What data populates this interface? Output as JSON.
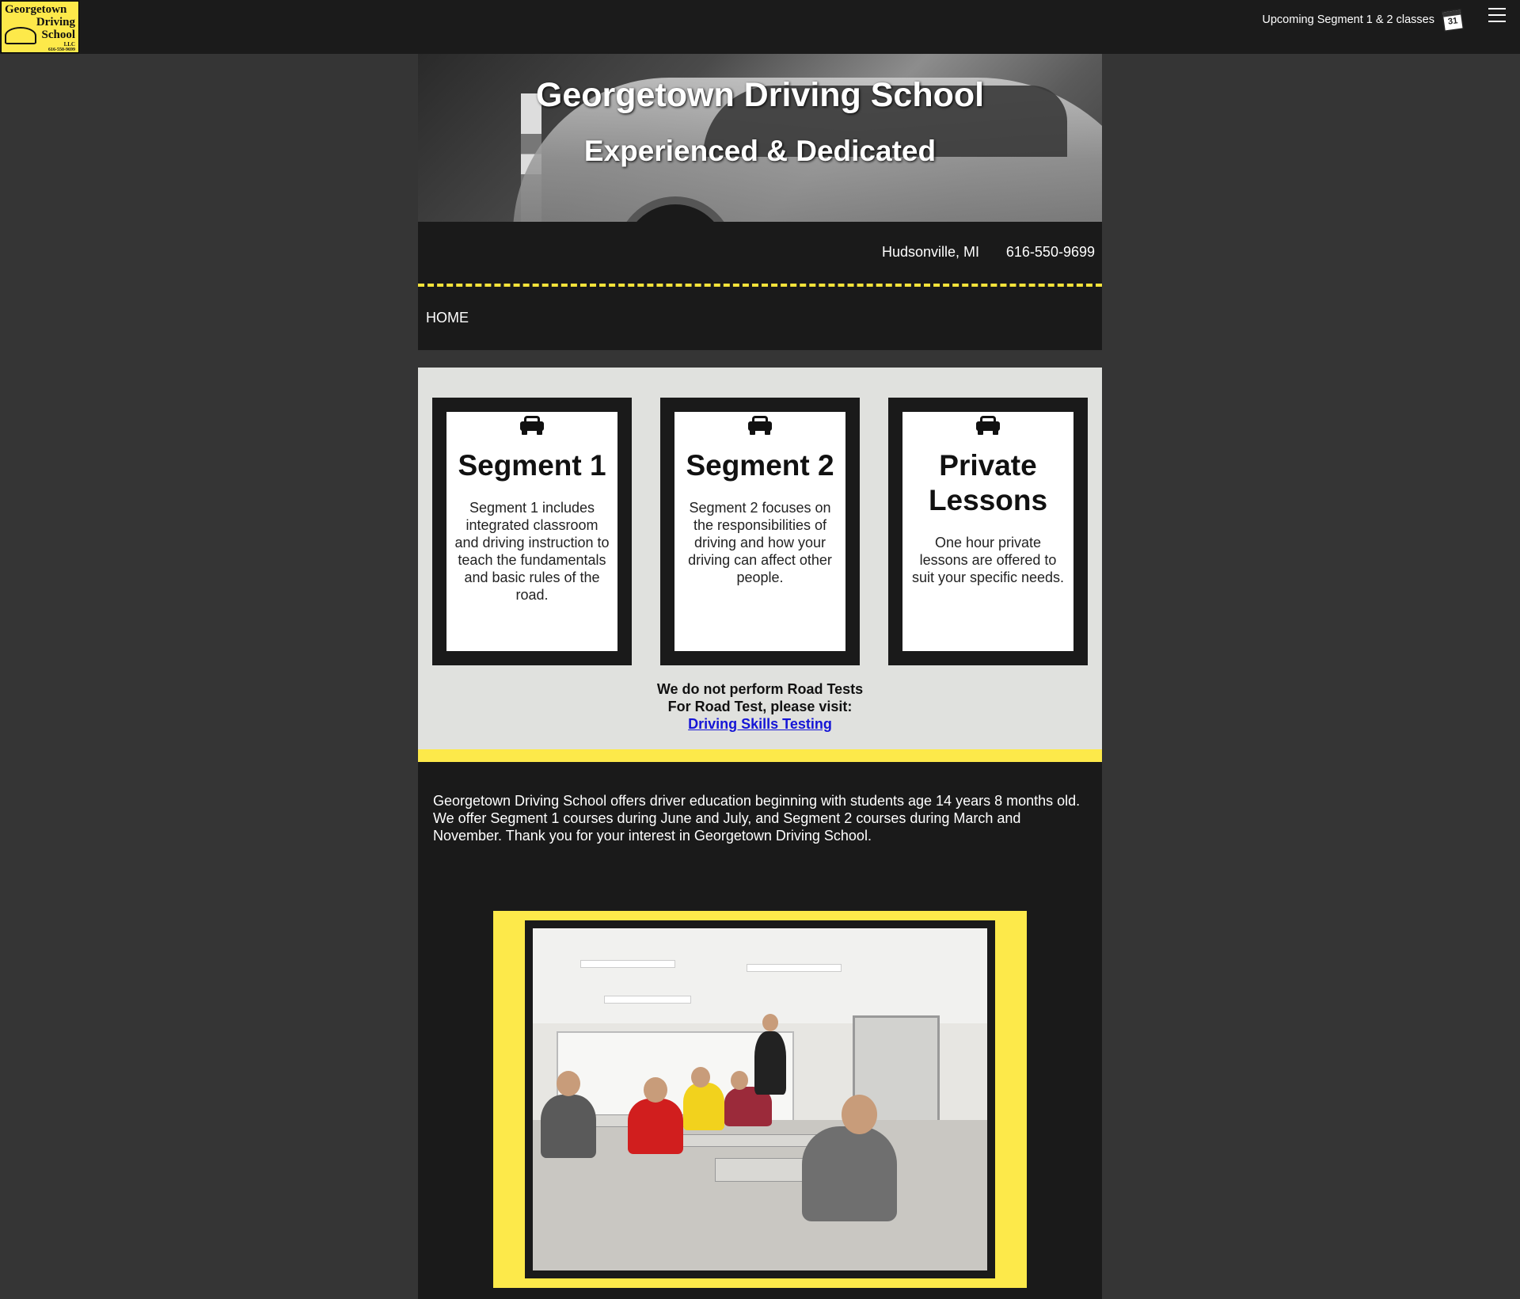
{
  "topbar": {
    "logo": {
      "line1": "Georgetown",
      "line2": "Driving",
      "line3": "School",
      "llc": "LLC",
      "phone": "616-550-9699"
    },
    "upcoming_label": "Upcoming Segment 1 & 2 classes",
    "calendar_number": "31",
    "menu_icon": "hamburger-icon"
  },
  "hero": {
    "title": "Georgetown Driving School",
    "subtitle": "Experienced & Dedicated"
  },
  "info": {
    "location": "Hudsonville, MI",
    "phone": "616-550-9699",
    "nav_home": "HOME"
  },
  "services": {
    "cards": [
      {
        "icon": "car-icon",
        "title": "Segment 1",
        "text": "Segment 1 includes integrated classroom and driving instruction to teach the fundamentals and basic rules of the road."
      },
      {
        "icon": "car-icon",
        "title": "Segment 2",
        "text": "Segment 2 focuses on the responsibilities of driving and how your driving can affect other people."
      },
      {
        "icon": "car-icon",
        "title": "Private Lessons",
        "text": "One hour private lessons are offered to suit your specific needs."
      }
    ],
    "road_note_line1": "We do not perform Road Tests",
    "road_note_line2": "For Road Test, please visit:",
    "road_link": "Driving Skills Testing"
  },
  "about": {
    "text": "Georgetown Driving School offers driver education beginning with students age 14 years 8 months old. We offer Segment 1 courses during June and July, and Segment 2 courses during March and November. Thank you for your interest in Georgetown Driving School."
  },
  "colors": {
    "accent_yellow": "#fde94a",
    "dark": "#1a1a1a",
    "link": "#1515d6"
  }
}
